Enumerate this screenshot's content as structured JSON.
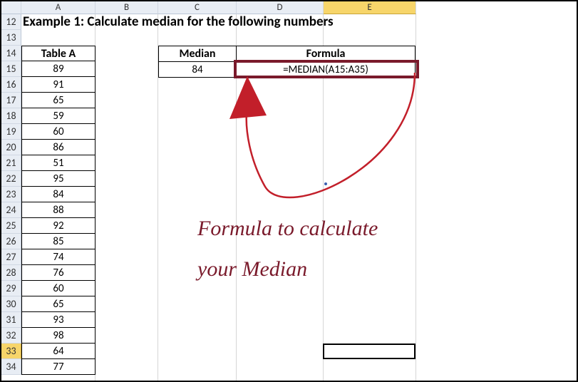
{
  "title": "Example 1: Calculate median for the following numbers",
  "columns": {
    "corner": "",
    "A": "A",
    "B": "B",
    "C": "C",
    "D": "D",
    "E": "E"
  },
  "column_widths": {
    "gutter": 28,
    "A": 104,
    "B": 88,
    "C": 110,
    "D": 122,
    "E": 130
  },
  "visible_rows": [
    12,
    13,
    14,
    15,
    16,
    17,
    18,
    19,
    20,
    21,
    22,
    23,
    24,
    25,
    26,
    27,
    28,
    29,
    30,
    31,
    32,
    33,
    34
  ],
  "selected_row": 33,
  "selected_col": "E",
  "tableA": {
    "header": "Table A",
    "values": [
      89,
      91,
      65,
      59,
      60,
      86,
      51,
      95,
      84,
      88,
      92,
      85,
      74,
      76,
      60,
      65,
      93,
      98,
      64,
      77
    ]
  },
  "median_block": {
    "header_median": "Median",
    "header_formula": "Formula",
    "median_value": 84,
    "formula_text": "=MEDIAN(A15:A35)"
  },
  "annotation": {
    "line1": "Formula to calculate",
    "line2": "your Median"
  },
  "active_cell": {
    "ref": "E33"
  }
}
